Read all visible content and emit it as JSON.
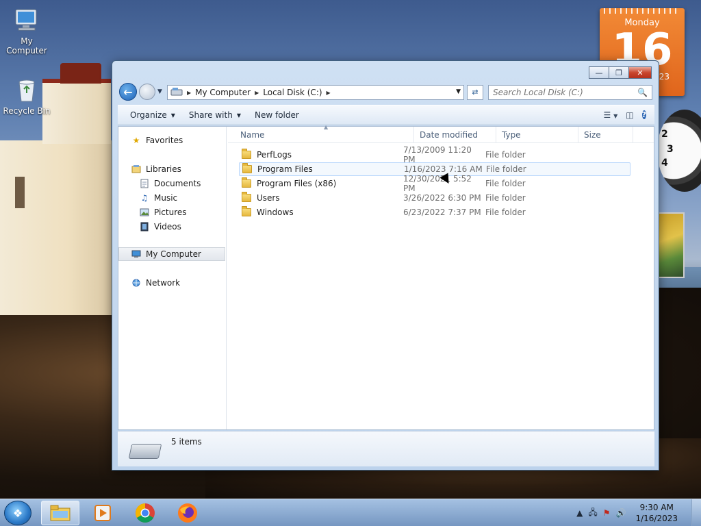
{
  "desktop": {
    "icons": [
      {
        "label": "My Computer"
      },
      {
        "label": "Recycle Bin"
      }
    ]
  },
  "gadgets": {
    "calendar": {
      "weekday": "Monday",
      "day": "16",
      "year_suffix": "23"
    },
    "clock": {
      "numerals": [
        "2",
        "3",
        "4"
      ]
    }
  },
  "window": {
    "address": {
      "crumbs": [
        "My Computer",
        "Local Disk (C:)"
      ]
    },
    "search": {
      "placeholder": "Search Local Disk (C:)"
    },
    "toolbar": {
      "organize": "Organize",
      "share_with": "Share with",
      "new_folder": "New folder"
    },
    "navpane": {
      "favorites": "Favorites",
      "libraries": "Libraries",
      "documents": "Documents",
      "music": "Music",
      "pictures": "Pictures",
      "videos": "Videos",
      "my_computer": "My Computer",
      "network": "Network"
    },
    "columns": {
      "name": "Name",
      "date_modified": "Date modified",
      "type": "Type",
      "size": "Size"
    },
    "files": [
      {
        "name": "PerfLogs",
        "date": "7/13/2009 11:20 PM",
        "type": "File folder"
      },
      {
        "name": "Program Files",
        "date": "1/16/2023 7:16 AM",
        "type": "File folder"
      },
      {
        "name": "Program Files (x86)",
        "date": "12/30/2021 5:52 PM",
        "type": "File folder"
      },
      {
        "name": "Users",
        "date": "3/26/2022 6:30 PM",
        "type": "File folder"
      },
      {
        "name": "Windows",
        "date": "6/23/2022 7:37 PM",
        "type": "File folder"
      }
    ],
    "status": {
      "item_count": "5 items"
    }
  },
  "taskbar": {
    "clock": {
      "time": "9:30 AM",
      "date": "1/16/2023"
    }
  }
}
